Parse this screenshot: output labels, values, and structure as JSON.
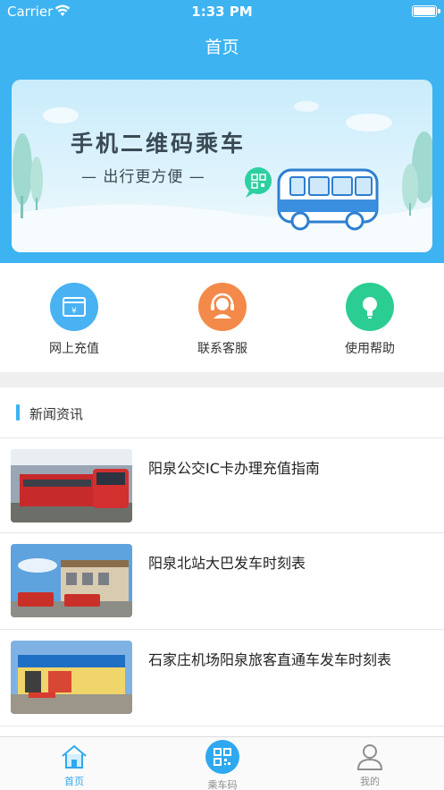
{
  "status_bar": {
    "carrier": "Carrier",
    "time": "1:33 PM"
  },
  "nav": {
    "title": "首页"
  },
  "banner": {
    "title": "手机二维码乘车",
    "subtitle": "— 出行更方便 —"
  },
  "shortcuts": [
    {
      "label": "网上充值",
      "icon": "wallet-icon",
      "color": "#48b2f2"
    },
    {
      "label": "联系客服",
      "icon": "headset-icon",
      "color": "#f38a4a"
    },
    {
      "label": "使用帮助",
      "icon": "bulb-icon",
      "color": "#2ccd92"
    }
  ],
  "news": {
    "heading": "新闻资讯",
    "items": [
      {
        "title": "阳泉公交IC卡办理充值指南"
      },
      {
        "title": "阳泉北站大巴发车时刻表"
      },
      {
        "title": "石家庄机场阳泉旅客直通车发车时刻表"
      }
    ]
  },
  "tabbar": {
    "items": [
      {
        "label": "首页",
        "icon": "home-icon",
        "active": true
      },
      {
        "label": "乘车码",
        "icon": "qr-code-icon",
        "active": false
      },
      {
        "label": "我的",
        "icon": "profile-icon",
        "active": false
      }
    ]
  },
  "colors": {
    "primary": "#3db3f1",
    "active_tab": "#2fa8ef",
    "inactive_tab": "#8e8e8e"
  }
}
